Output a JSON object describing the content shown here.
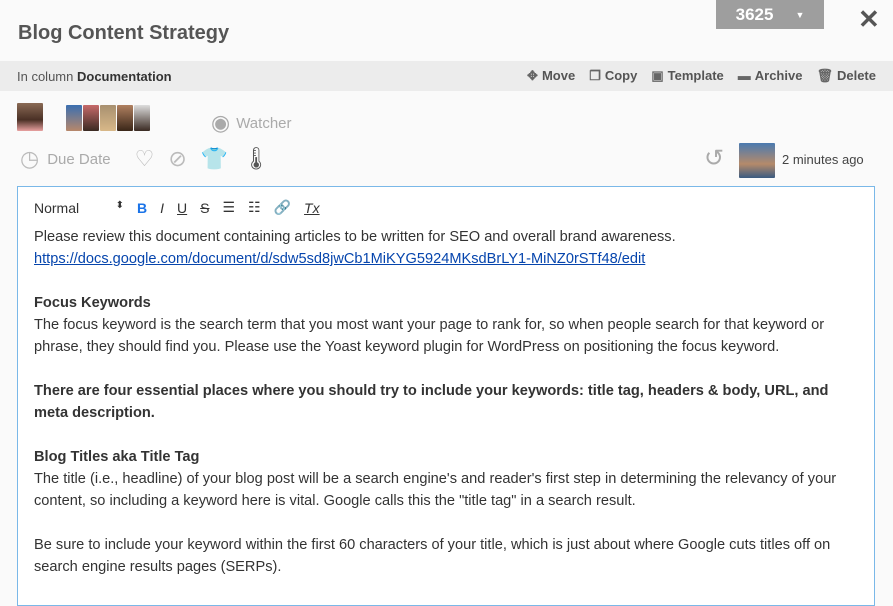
{
  "card": {
    "title": "Blog Content Strategy",
    "id": "3625"
  },
  "bar": {
    "prefix": "In column",
    "column": "Documentation",
    "actions": [
      {
        "icon": "move-icon",
        "glyph": "✥",
        "label": "Move"
      },
      {
        "icon": "copy-icon",
        "glyph": "❐",
        "label": "Copy"
      },
      {
        "icon": "template-icon",
        "glyph": "▣",
        "label": "Template"
      },
      {
        "icon": "archive-icon",
        "glyph": "▬",
        "label": "Archive"
      },
      {
        "icon": "delete-icon",
        "glyph": "🗑",
        "label": "Delete"
      }
    ]
  },
  "members": {
    "watcher_label": "Watcher"
  },
  "meta": {
    "due_date": "Due Date",
    "updated": "2 minutes ago"
  },
  "toolbar": {
    "format": "Normal"
  },
  "content": {
    "intro": "Please review this document containing articles to be written for SEO and overall brand awareness.",
    "link": "https://docs.google.com/document/d/sdw5sd8jwCb1MiKYG5924MKsdBrLY1-MiNZ0rSTf48/edit",
    "h1": "Focus Keywords",
    "p1": "The focus keyword is the search term that you most want your page to rank for, so when people search for that keyword or phrase, they should find you. Please use the Yoast keyword plugin for WordPress on positioning the focus keyword.",
    "bold": "There are four essential places where you should try to include your keywords: title tag, headers & body, URL, and meta description.",
    "h2": "Blog Titles aka Title Tag",
    "p2": "The title (i.e., headline) of your blog post will be a search engine's and reader's first step in determining the relevancy of your content, so including a keyword here is vital. Google calls this the \"title tag\" in a search result.",
    "p3": "Be sure to include your keyword within the first 60 characters of your title, which is just about where Google cuts titles off on search engine results pages (SERPs)."
  }
}
